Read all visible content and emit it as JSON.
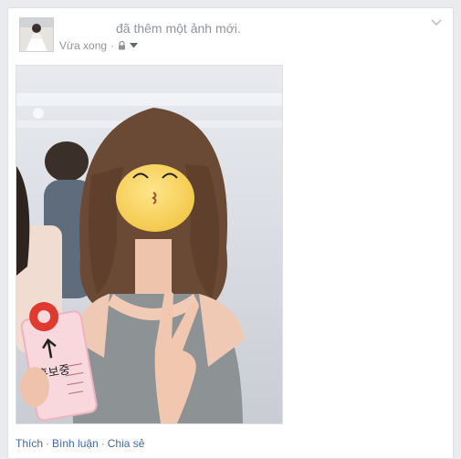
{
  "post": {
    "action_text": "đã thêm một ảnh mới.",
    "timestamp": "Vừa xong",
    "meta_separator": "·",
    "privacy_icon": "lock-icon",
    "audience_menu_icon": "caret-down-icon",
    "options_icon": "chevron-down-icon",
    "photo_sign_text": "홍보중"
  },
  "actions": {
    "like": "Thích",
    "comment": "Bình luận",
    "share": "Chia sẻ",
    "separator": "·"
  },
  "colors": {
    "link": "#4267b2",
    "meta_text": "#90949c",
    "background": "#e9ebee",
    "card": "#ffffff"
  }
}
